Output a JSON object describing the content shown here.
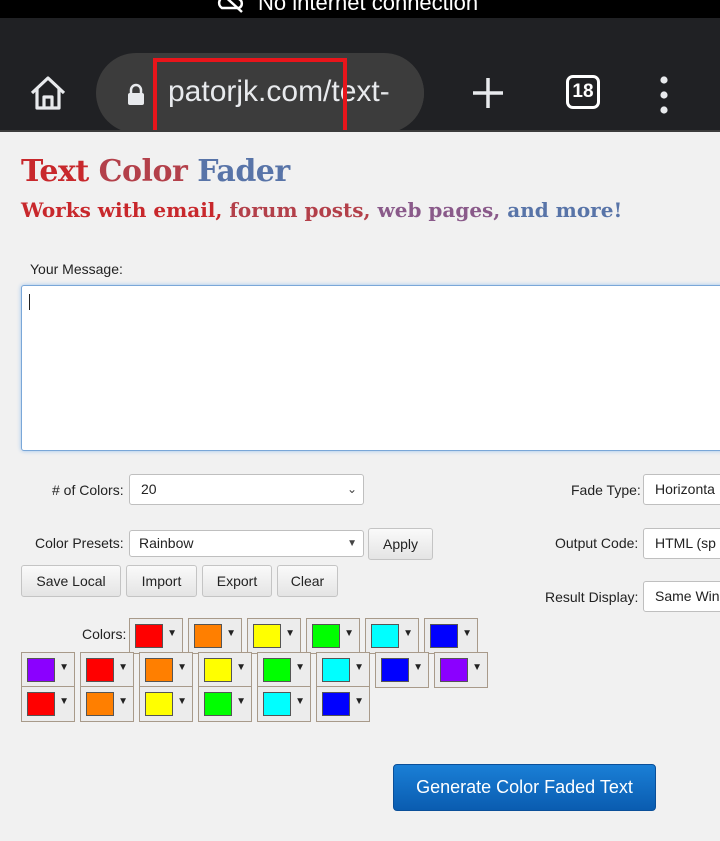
{
  "status_bar": {
    "text": "No internet connection"
  },
  "browser": {
    "url": "patorjk.com/text-",
    "tab_count": "18"
  },
  "page": {
    "title_words": [
      "Text",
      "Color",
      "Fader"
    ],
    "subtitle_words": [
      "Works with email,",
      "forum posts,",
      "web pages,",
      "and more!"
    ],
    "message_label": "Your Message:",
    "message_value": "",
    "num_colors_label": "# of Colors:",
    "num_colors_value": "20",
    "fade_type_label": "Fade Type:",
    "fade_type_value": "Horizonta",
    "presets_label": "Color Presets:",
    "presets_value": "Rainbow",
    "apply_label": "Apply",
    "output_code_label": "Output Code:",
    "output_code_value": "HTML (sp",
    "save_local_label": "Save Local",
    "import_label": "Import",
    "export_label": "Export",
    "clear_label": "Clear",
    "result_display_label": "Result Display:",
    "result_display_value": "Same Win",
    "colors_label": "Colors:",
    "colors": [
      "#ff0000",
      "#ff7f00",
      "#ffff00",
      "#00ff00",
      "#00ffff",
      "#0000ff",
      "#8b00ff",
      "#ff0000",
      "#ff7f00",
      "#ffff00",
      "#00ff00",
      "#00ffff",
      "#0000ff",
      "#8b00ff",
      "#ff0000",
      "#ff7f00",
      "#ffff00",
      "#00ff00",
      "#00ffff",
      "#0000ff"
    ],
    "generate_label": "Generate Color Faded Text"
  }
}
